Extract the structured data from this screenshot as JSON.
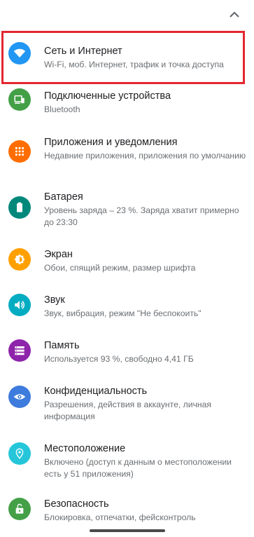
{
  "items": [
    {
      "title": "Сеть и Интернет",
      "subtitle": "Wi-Fi, моб. Интернет, трафик и точка доступа",
      "icon": "wifi-icon",
      "color": "#2196f3"
    },
    {
      "title": "Подключенные устройства",
      "subtitle": "Bluetooth",
      "icon": "connected-devices-icon",
      "color": "#43a047"
    },
    {
      "title": "Приложения и уведомления",
      "subtitle": "Недавние приложения, приложения по умолчанию",
      "icon": "apps-grid-icon",
      "color": "#ff6d00"
    },
    {
      "title": "Батарея",
      "subtitle": "Уровень заряда – 23 %. Заряда хватит примерно до 23:30",
      "icon": "battery-icon",
      "color": "#00897b"
    },
    {
      "title": "Экран",
      "subtitle": "Обои, спящий режим, размер шрифта",
      "icon": "display-brightness-icon",
      "color": "#ffa000"
    },
    {
      "title": "Звук",
      "subtitle": "Звук, вибрация, режим \"Не беспокоить\"",
      "icon": "volume-icon",
      "color": "#00acc1"
    },
    {
      "title": "Память",
      "subtitle": "Используется 93 %, свободно 4,41 ГБ",
      "icon": "storage-icon",
      "color": "#8e24aa"
    },
    {
      "title": "Конфиденциальность",
      "subtitle": "Разрешения, действия в аккаунте, личная информация",
      "icon": "privacy-eye-icon",
      "color": "#3d7bdc"
    },
    {
      "title": "Местоположение",
      "subtitle": "Включено (доступ к данным о местоположении есть у 51 приложения)",
      "icon": "location-pin-icon",
      "color": "#26c6da"
    },
    {
      "title": "Безопасность",
      "subtitle": "Блокировка, отпечатки, фейсконтроль",
      "icon": "lock-open-icon",
      "color": "#43a047"
    }
  ]
}
